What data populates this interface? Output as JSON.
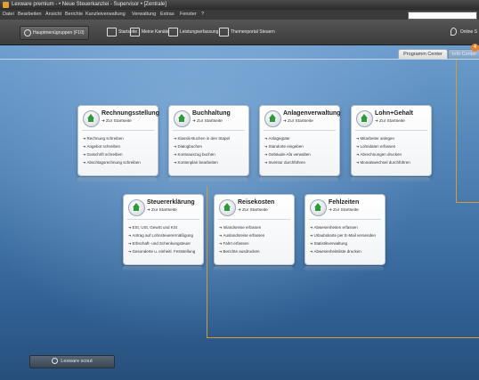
{
  "window": {
    "title": "Lexware premium - • Neue Steuerkanzlei - Supervisor • [Zentrale]"
  },
  "menu": [
    "Datei",
    "Bearbeiten",
    "Ansicht",
    "Berichte",
    "Kanzleiverwaltung",
    "Verwaltung",
    "Extras",
    "Fenster",
    "?"
  ],
  "toolbar": {
    "hauptmenu": "Hauptmenügruppen (F10)",
    "items": [
      "Startseite",
      "Meine Kanäle",
      "Leistungserfassung",
      "Themenportal Steuern"
    ],
    "online": "Online S"
  },
  "tabs": {
    "programm_center": "Programm Center",
    "info_center": "Info Center",
    "badge": "4"
  },
  "cards": [
    {
      "title": "Rechnungsstellung",
      "sub": "Zur Startseite",
      "items": [
        "Rechnung schreiben",
        "Angebot schreiben",
        "Gutschrift schreiben",
        "Abschlagsrechnung schreiben"
      ]
    },
    {
      "title": "Buchhaltung",
      "sub": "Zur Startseite",
      "items": [
        "Klassik-Buchen in den Stapel",
        "Dialogbuchen",
        "Kontoauszug buchen",
        "Kontenplan bearbeiten"
      ]
    },
    {
      "title": "Anlagenverwaltung",
      "sub": "Zur Startseite",
      "items": [
        "Anlagegüter",
        "Standorte eingeben",
        "Gebäude-Afa verwalten",
        "Inventur durchführen"
      ]
    },
    {
      "title": "Lohn+Gehalt",
      "sub": "Zur Startseite",
      "items": [
        "Mitarbeiter anlegen",
        "Lohndaten erfassen",
        "Abrechnungen drucken",
        "Monatswechsel durchführen"
      ]
    },
    {
      "title": "Steuererklärung",
      "sub": "Zur Startseite",
      "items": [
        "ESt, USt, GewSt und KSt",
        "Antrag auf Lohnsteuerermäßigung",
        "Erbschaft- und Schenkungsteuer",
        "Gesonderte u. einheitl. Feststellung"
      ]
    },
    {
      "title": "Reisekosten",
      "sub": "Zur Startseite",
      "items": [
        "Inlandsreise erfassen",
        "Auslandsreise erfassen",
        "Fahrt erfassen",
        "Berichte ausdrucken"
      ]
    },
    {
      "title": "Fehlzeiten",
      "sub": "Zur Startseite",
      "items": [
        "Abwesenheiten erfassen",
        "Urlaubskarte per E-Mail versenden",
        "Statistikverwaltung",
        "Abwesenheitsliste drucken"
      ]
    }
  ],
  "scout": "Lexware scout"
}
